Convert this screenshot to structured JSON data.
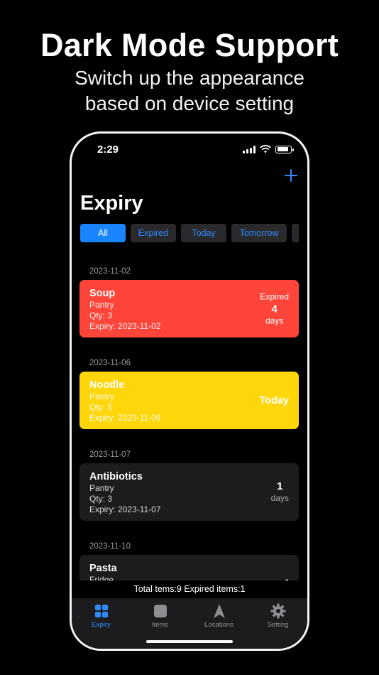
{
  "promo": {
    "headline": "Dark Mode Support",
    "subline1": "Switch up the appearance",
    "subline2": "based on device setting"
  },
  "status_bar": {
    "time": "2:29"
  },
  "header": {
    "title": "Expiry",
    "add_icon": "plus-icon"
  },
  "filters": [
    "All",
    "Expired",
    "Today",
    "Tomorrow",
    ""
  ],
  "groups": [
    {
      "date": "2023-11-02",
      "item": {
        "name": "Soup",
        "location": "Pantry",
        "qty": "Qty: 3",
        "expiry": "Expiry: 2023-11-02",
        "status_top": "Expired",
        "status_value": "4",
        "status_unit": "days",
        "color": "#ff453a"
      }
    },
    {
      "date": "2023-11-06",
      "item": {
        "name": "Noodle",
        "location": "Pantry",
        "qty": "Qty: 5",
        "expiry": "Expiry: 2023-11-06",
        "status_label": "Today",
        "color": "#ffd60a"
      }
    },
    {
      "date": "2023-11-07",
      "item": {
        "name": "Antibiotics",
        "location": "Pantry",
        "qty": "Qty: 3",
        "expiry": "Expiry: 2023-11-07",
        "status_value": "1",
        "status_unit": "days",
        "color": "#1c1c1e"
      }
    },
    {
      "date": "2023-11-10",
      "item": {
        "name": "Pasta",
        "location": "Fridge",
        "status_value": "4",
        "color": "#1c1c1e"
      }
    }
  ],
  "summary": "Total tems:9  Expired items:1",
  "tabs": [
    {
      "label": "Expiry",
      "icon": "grid-icon"
    },
    {
      "label": "Items",
      "icon": "square-icon"
    },
    {
      "label": "Locations",
      "icon": "location-arrow-icon"
    },
    {
      "label": "Setting",
      "icon": "gear-icon"
    }
  ],
  "colors": {
    "accent": "#2e8cff",
    "expired": "#ff453a",
    "today": "#ffd60a",
    "card": "#1c1c1e"
  }
}
